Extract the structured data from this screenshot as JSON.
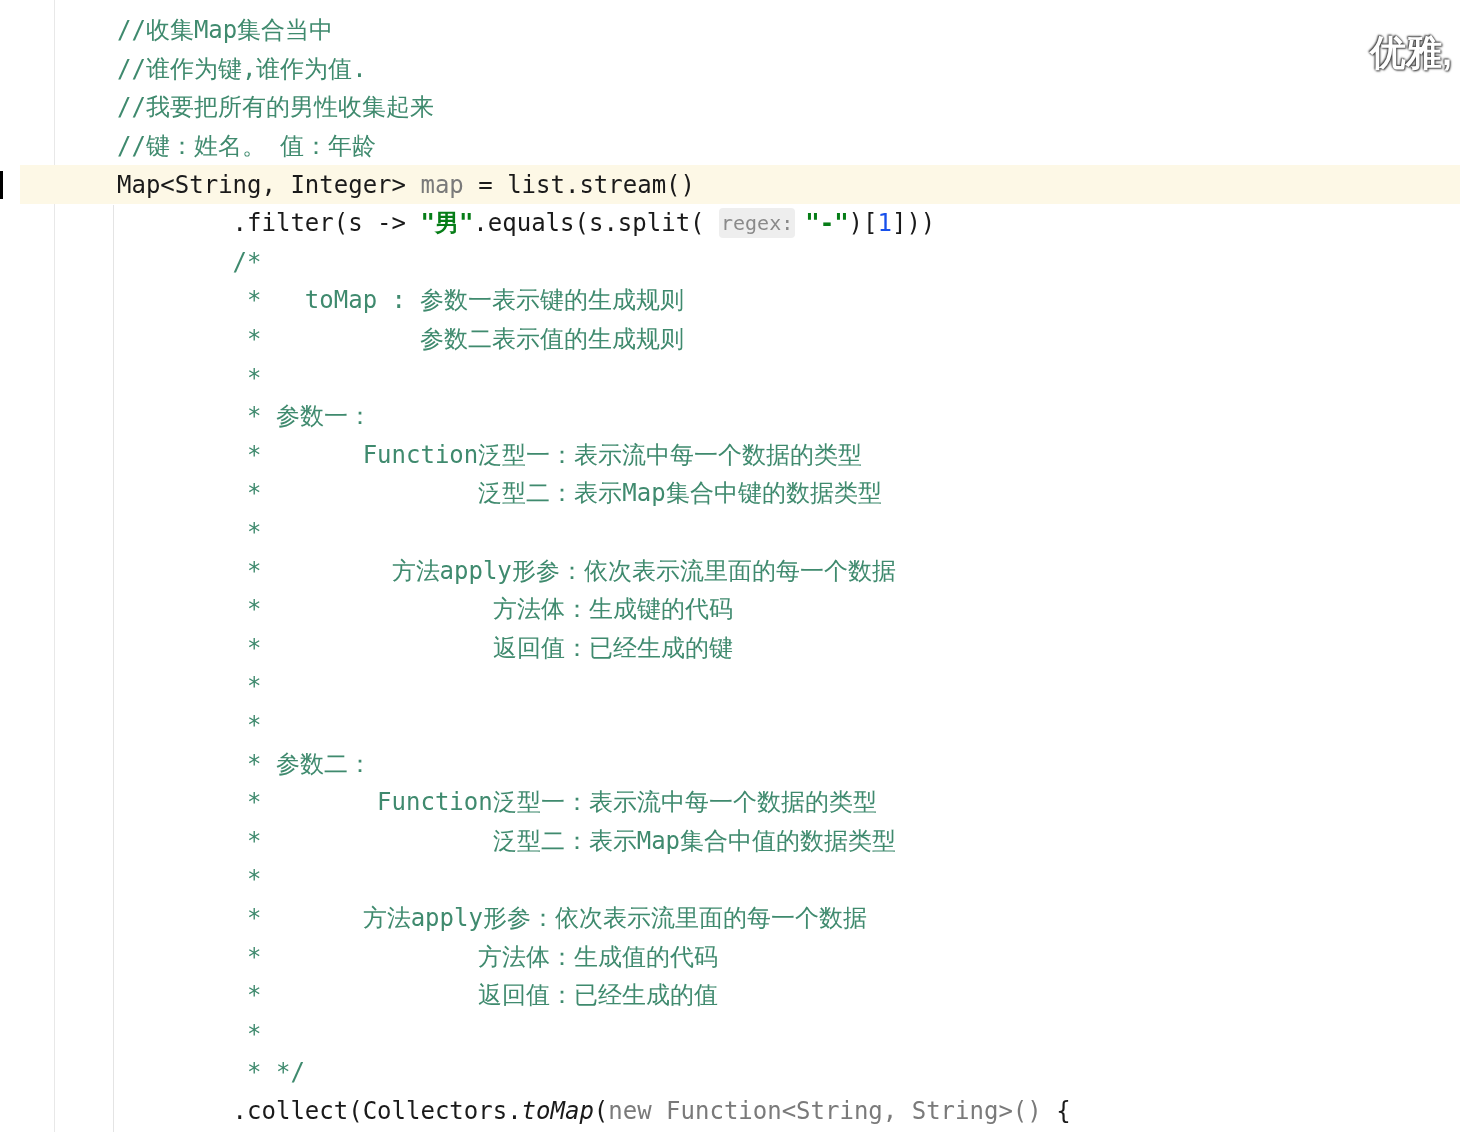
{
  "editor": {
    "lines": [
      {
        "current": false,
        "tokens": [
          {
            "text": "//收集Map集合当中",
            "kind": "comment"
          }
        ]
      },
      {
        "current": false,
        "tokens": [
          {
            "text": "//谁作为键,谁作为值.",
            "kind": "comment"
          }
        ]
      },
      {
        "current": false,
        "tokens": [
          {
            "text": "//我要把所有的男性收集起来",
            "kind": "comment"
          }
        ]
      },
      {
        "current": false,
        "tokens": [
          {
            "text": "//键：姓名。 值：年龄",
            "kind": "comment"
          }
        ]
      },
      {
        "current": true,
        "tokens": [
          {
            "text": "Map<String, Integer> ",
            "kind": "plain"
          },
          {
            "text": "map",
            "kind": "muted"
          },
          {
            "text": " = list.stream()",
            "kind": "plain"
          }
        ]
      },
      {
        "current": false,
        "tokens": [
          {
            "text": "        .filter(s -> ",
            "kind": "plain"
          },
          {
            "text": "\"男\"",
            "kind": "string"
          },
          {
            "text": ".equals(s.split( ",
            "kind": "plain"
          },
          {
            "text": "regex:",
            "kind": "hint"
          },
          {
            "text": "\"-\"",
            "kind": "string"
          },
          {
            "text": ")[",
            "kind": "plain"
          },
          {
            "text": "1",
            "kind": "number"
          },
          {
            "text": "]))",
            "kind": "plain"
          }
        ]
      },
      {
        "current": false,
        "tokens": [
          {
            "text": "        /*",
            "kind": "comment"
          }
        ]
      },
      {
        "current": false,
        "tokens": [
          {
            "text": "         *   toMap : 参数一表示键的生成规则",
            "kind": "comment"
          }
        ]
      },
      {
        "current": false,
        "tokens": [
          {
            "text": "         *           参数二表示值的生成规则",
            "kind": "comment"
          }
        ]
      },
      {
        "current": false,
        "tokens": [
          {
            "text": "         *",
            "kind": "comment"
          }
        ]
      },
      {
        "current": false,
        "tokens": [
          {
            "text": "         * 参数一：",
            "kind": "comment"
          }
        ]
      },
      {
        "current": false,
        "tokens": [
          {
            "text": "         *       Function泛型一：表示流中每一个数据的类型",
            "kind": "comment"
          }
        ]
      },
      {
        "current": false,
        "tokens": [
          {
            "text": "         *               泛型二：表示Map集合中键的数据类型",
            "kind": "comment"
          }
        ]
      },
      {
        "current": false,
        "tokens": [
          {
            "text": "         *",
            "kind": "comment"
          }
        ]
      },
      {
        "current": false,
        "tokens": [
          {
            "text": "         *         方法apply形参：依次表示流里面的每一个数据",
            "kind": "comment"
          }
        ]
      },
      {
        "current": false,
        "tokens": [
          {
            "text": "         *                方法体：生成键的代码",
            "kind": "comment"
          }
        ]
      },
      {
        "current": false,
        "tokens": [
          {
            "text": "         *                返回值：已经生成的键",
            "kind": "comment"
          }
        ]
      },
      {
        "current": false,
        "tokens": [
          {
            "text": "         *",
            "kind": "comment"
          }
        ]
      },
      {
        "current": false,
        "tokens": [
          {
            "text": "         *",
            "kind": "comment"
          }
        ]
      },
      {
        "current": false,
        "tokens": [
          {
            "text": "         * 参数二：",
            "kind": "comment"
          }
        ]
      },
      {
        "current": false,
        "tokens": [
          {
            "text": "         *        Function泛型一：表示流中每一个数据的类型",
            "kind": "comment"
          }
        ]
      },
      {
        "current": false,
        "tokens": [
          {
            "text": "         *                泛型二：表示Map集合中值的数据类型",
            "kind": "comment"
          }
        ]
      },
      {
        "current": false,
        "tokens": [
          {
            "text": "         *",
            "kind": "comment"
          }
        ]
      },
      {
        "current": false,
        "tokens": [
          {
            "text": "         *       方法apply形参：依次表示流里面的每一个数据",
            "kind": "comment"
          }
        ]
      },
      {
        "current": false,
        "tokens": [
          {
            "text": "         *               方法体：生成值的代码",
            "kind": "comment"
          }
        ]
      },
      {
        "current": false,
        "tokens": [
          {
            "text": "         *               返回值：已经生成的值",
            "kind": "comment"
          }
        ]
      },
      {
        "current": false,
        "tokens": [
          {
            "text": "         *",
            "kind": "comment"
          }
        ]
      },
      {
        "current": false,
        "tokens": [
          {
            "text": "         * */",
            "kind": "comment"
          }
        ]
      },
      {
        "current": false,
        "tokens": [
          {
            "text": "        .collect(Collectors.",
            "kind": "plain"
          },
          {
            "text": "toMap",
            "kind": "italic"
          },
          {
            "text": "(",
            "kind": "plain"
          },
          {
            "text": "new Function<String, String>()",
            "kind": "muted"
          },
          {
            "text": " {",
            "kind": "plain"
          }
        ]
      }
    ]
  },
  "overlay_comment": "优雅,"
}
